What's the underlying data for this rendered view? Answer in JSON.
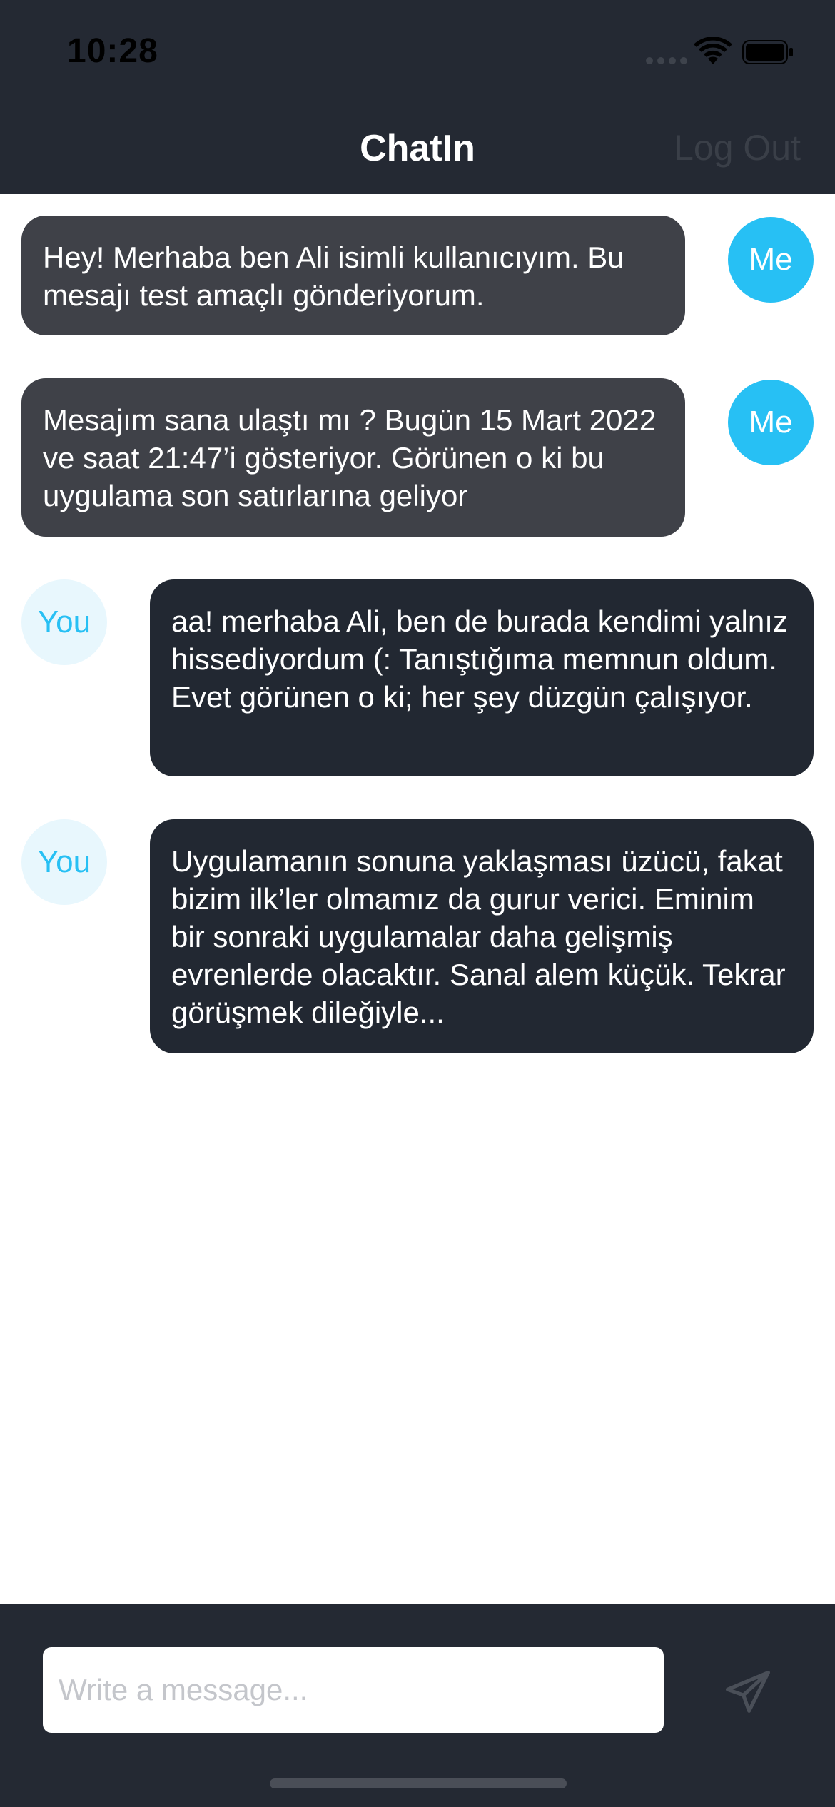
{
  "status_bar": {
    "time": "10:28"
  },
  "header": {
    "title": "ChatIn",
    "logout_label": "Log Out"
  },
  "messages": [
    {
      "sender": "me",
      "avatar": "Me",
      "text": "Hey! Merhaba ben Ali isimli kullanıcıyım. Bu mesajı test amaçlı gönderiyorum."
    },
    {
      "sender": "me",
      "avatar": "Me",
      "text": "Mesajım sana ulaştı mı ? Bugün 15 Mart 2022 ve saat 21:47’i gösteriyor. Görünen o ki bu uygulama son satırlarına geliyor"
    },
    {
      "sender": "you",
      "avatar": "You",
      "text": "aa! merhaba Ali, ben de burada kendimi yalnız hissediyordum (: Tanıştığıma memnun oldum. Evet görünen o ki; her şey düzgün çalışıyor."
    },
    {
      "sender": "you",
      "avatar": "You",
      "text": "Uygulamanın sonuna yaklaşması üzücü, fakat bizim ilk’ler olmamız da gurur verici. Eminim bir sonraki uygulamalar daha gelişmiş evrenlerde olacaktır. Sanal alem küçük. Tekrar görüşmek dileğiyle..."
    }
  ],
  "composer": {
    "placeholder": "Write a message...",
    "value": ""
  },
  "icons": {
    "signal": "signal-icon",
    "wifi": "wifi-icon",
    "battery": "battery-icon",
    "send": "send-icon"
  },
  "colors": {
    "header_bg": "#242933",
    "me_bubble": "#3f4148",
    "you_bubble": "#222832",
    "accent": "#27c0f4",
    "you_avatar_bg": "#e8f7fd"
  }
}
